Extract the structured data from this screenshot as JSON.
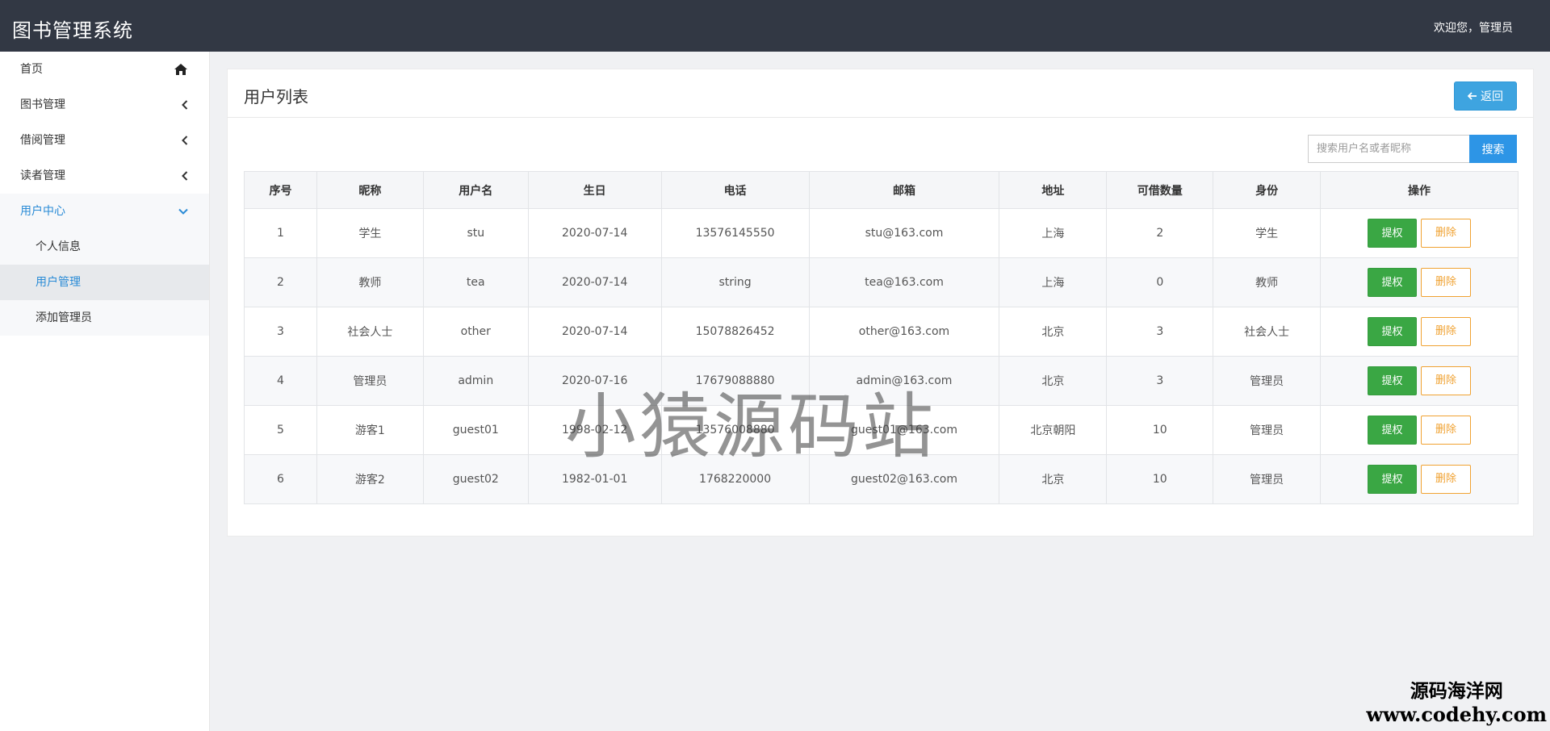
{
  "header": {
    "app_title": "图书管理系统",
    "welcome": "欢迎您，管理员"
  },
  "sidebar": {
    "items": [
      {
        "label": "首页",
        "icon": "home-icon"
      },
      {
        "label": "图书管理",
        "icon": "chevron-left-icon"
      },
      {
        "label": "借阅管理",
        "icon": "chevron-left-icon"
      },
      {
        "label": "读者管理",
        "icon": "chevron-left-icon"
      },
      {
        "label": "用户中心",
        "icon": "chevron-down-icon",
        "expanded": true
      }
    ],
    "sub_items": [
      {
        "label": "个人信息"
      },
      {
        "label": "用户管理",
        "active": true
      },
      {
        "label": "添加管理员"
      }
    ]
  },
  "panel": {
    "title": "用户列表",
    "back_label": "返回",
    "back_icon": "arrow-left-icon"
  },
  "search": {
    "placeholder": "搜索用户名或者昵称",
    "button_label": "搜索"
  },
  "table": {
    "headers": [
      "序号",
      "昵称",
      "用户名",
      "生日",
      "电话",
      "邮箱",
      "地址",
      "可借数量",
      "身份",
      "操作"
    ],
    "rows": [
      [
        "1",
        "学生",
        "stu",
        "2020-07-14",
        "13576145550",
        "stu@163.com",
        "上海",
        "2",
        "学生"
      ],
      [
        "2",
        "教师",
        "tea",
        "2020-07-14",
        "string",
        "tea@163.com",
        "上海",
        "0",
        "教师"
      ],
      [
        "3",
        "社会人士",
        "other",
        "2020-07-14",
        "15078826452",
        "other@163.com",
        "北京",
        "3",
        "社会人士"
      ],
      [
        "4",
        "管理员",
        "admin",
        "2020-07-16",
        "17679088880",
        "admin@163.com",
        "北京",
        "3",
        "管理员"
      ],
      [
        "5",
        "游客1",
        "guest01",
        "1998-02-12",
        "13576008880",
        "guest01@163.com",
        "北京朝阳",
        "10",
        "管理员"
      ],
      [
        "6",
        "游客2",
        "guest02",
        "1982-01-01",
        "1768220000",
        "guest02@163.com",
        "北京",
        "10",
        "管理员"
      ]
    ],
    "grant_label": "提权",
    "delete_label": "删除"
  },
  "watermarks": {
    "center": "小猿源码站",
    "corner_line1": "源码海洋网",
    "corner_line2": "www.codehy.com"
  },
  "colors": {
    "header_bg": "#323844",
    "accent_blue": "#2a8bd6",
    "grant_green": "#3aa744",
    "delete_orange": "#f0a232"
  }
}
